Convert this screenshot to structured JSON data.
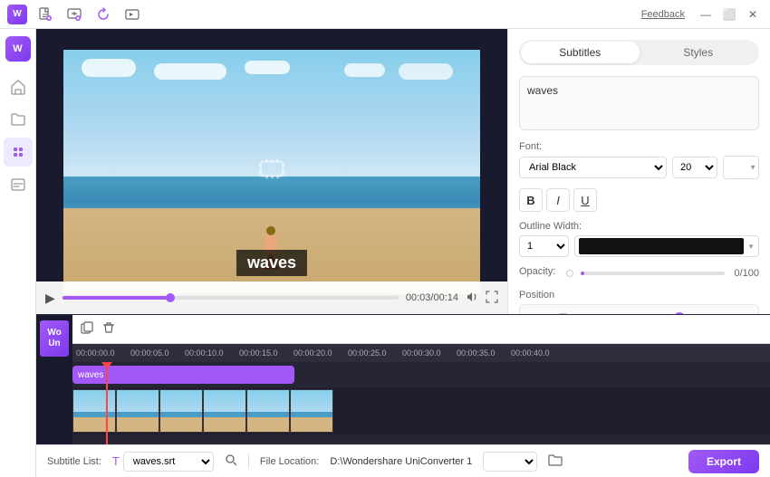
{
  "titlebar": {
    "feedback_label": "Feedback",
    "app_icon": "W",
    "toolbar_icons": [
      {
        "name": "new-file-icon",
        "glyph": "📄"
      },
      {
        "name": "open-file-icon",
        "glyph": "📂"
      },
      {
        "name": "refresh-icon",
        "glyph": "↺"
      },
      {
        "name": "export-icon",
        "glyph": "📤"
      }
    ],
    "window_controls": [
      "—",
      "⬜",
      "✕"
    ]
  },
  "sidebar": {
    "logo": "W",
    "items": [
      {
        "name": "home-item",
        "icon": "⌂",
        "active": false
      },
      {
        "name": "folder-item",
        "icon": "📁",
        "active": false
      },
      {
        "name": "effects-item",
        "icon": "✦",
        "active": true
      },
      {
        "name": "subtitle-item",
        "icon": "📝",
        "active": false
      }
    ]
  },
  "video": {
    "subtitle_text": "waves",
    "time_current": "00:03",
    "time_total": "00:14",
    "progress_percent": 32
  },
  "panel": {
    "tabs": [
      "Subtitles",
      "Styles"
    ],
    "active_tab": "Subtitles",
    "subtitle_content": "waves",
    "font": {
      "label": "Font:",
      "family": "Arial Black",
      "size": "20",
      "color": "#ffffff"
    },
    "format_buttons": [
      "B",
      "I",
      "U"
    ],
    "outline": {
      "label": "Outline Width:",
      "width": "1",
      "color": "#111111"
    },
    "opacity": {
      "label": "Opacity:",
      "value": 0,
      "display": "0/100"
    },
    "position_label": "Position"
  },
  "timeline": {
    "toolbar_icons": [
      "copy-icon",
      "delete-icon"
    ],
    "ruler_labels": [
      "00:00:00.0",
      "00:00:05.0",
      "00:00:10.0",
      "00:00:15.0",
      "00:00:20.0",
      "00:00:25.0",
      "00:00:30.0",
      "00:00:35.0",
      "00:00:40.0"
    ],
    "subtitle_clip_label": "waves",
    "toggle_label_line1": "Wo",
    "toggle_label_line2": "Un"
  },
  "bottom_bar": {
    "subtitle_list_label": "Subtitle List:",
    "subtitle_file": "waves.srt",
    "file_location_label": "File Location:",
    "file_path": "D:\\Wondershare UniConverter 1",
    "export_label": "Export"
  }
}
